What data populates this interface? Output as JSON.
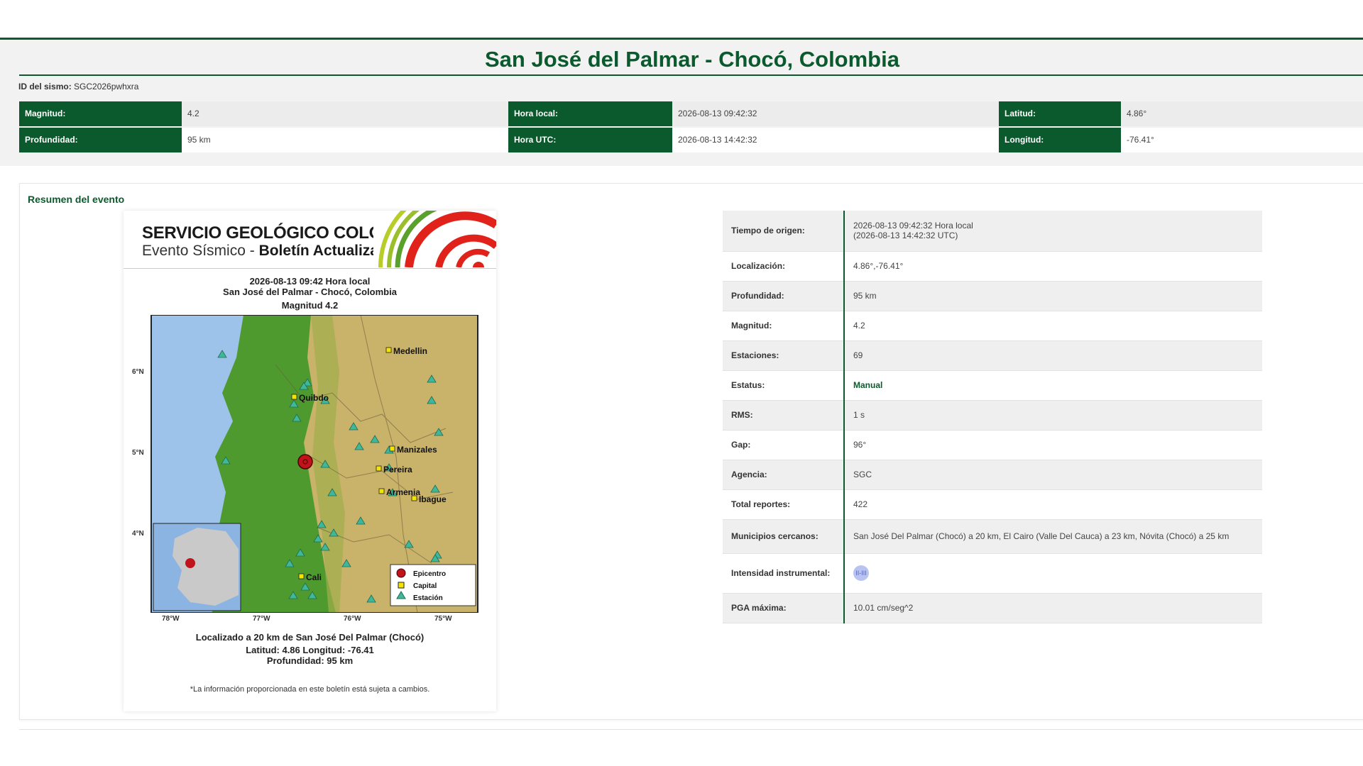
{
  "header": {
    "title": "San José del Palmar - Chocó, Colombia",
    "event_id_label": "ID del sismo:",
    "event_id_value": "SGC2026pwhxra"
  },
  "summary": {
    "magnitude_label": "Magnitud:",
    "magnitude_value": "4.2",
    "depth_label": "Profundidad:",
    "depth_value": "95 km",
    "local_time_label": "Hora local:",
    "local_time_value": "2026-08-13 09:42:32",
    "utc_time_label": "Hora UTC:",
    "utc_time_value": "2026-08-13 14:42:32",
    "latitude_label": "Latitud:",
    "latitude_value": "4.86°",
    "longitude_label": "Longitud:",
    "longitude_value": "-76.41°"
  },
  "section": {
    "title": "Resumen del evento"
  },
  "bulletin": {
    "org_name": "SERVICIO GEOLÓGICO COLOMBIANO",
    "subtitle_prefix": "Evento Sísmico - ",
    "subtitle_bold": "Boletín Actualizado",
    "caption_datetime": "2026-08-13 09:42 Hora local",
    "caption_place": "San José del Palmar - Chocó, Colombia",
    "caption_magnitude": "Magnitud 4.2",
    "location_text": "Localizado a 20 km de San José Del Palmar (Chocó)",
    "coords_text": "Latitud: 4.86 Longitud: -76.41",
    "depth_text": "Profundidad: 95 km",
    "disclaimer": "*La información proporcionada en este boletín está sujeta a cambios.",
    "map": {
      "lat_ticks": [
        "6°N",
        "5°N",
        "4°N"
      ],
      "lon_ticks": [
        "78°W",
        "77°W",
        "76°W",
        "75°W"
      ],
      "cities": [
        "Medellin",
        "Quibdo",
        "Manizales",
        "Pereira",
        "Armenia",
        "Ibague",
        "Cali"
      ],
      "legend": {
        "epicenter": "Epicentro",
        "capital": "Capital",
        "station": "Estación"
      },
      "colors": {
        "sea": "#9ec3ea",
        "lowland": "#4f9a2f",
        "highland": "#c9b26a",
        "epicenter": "#c0141a",
        "capital": "#f5e400",
        "station": "#3fb89a"
      }
    }
  },
  "details": {
    "origin_time_label": "Tiempo de origen:",
    "origin_time_line1": "2026-08-13 09:42:32 Hora local",
    "origin_time_line2": "(2026-08-13 14:42:32 UTC)",
    "location_label": "Localización:",
    "location_value": "4.86°,-76.41°",
    "depth_label": "Profundidad:",
    "depth_value": "95 km",
    "magnitude_label": "Magnitud:",
    "magnitude_value": "4.2",
    "stations_label": "Estaciones:",
    "stations_value": "69",
    "status_label": "Estatus:",
    "status_value": "Manual",
    "rms_label": "RMS:",
    "rms_value": "1 s",
    "gap_label": "Gap:",
    "gap_value": "96°",
    "agency_label": "Agencia:",
    "agency_value": "SGC",
    "reports_label": "Total reportes:",
    "reports_value": "422",
    "nearby_label": "Municipios cercanos:",
    "nearby_value": "San José Del Palmar (Chocó) a 20 km, El Cairo (Valle Del Cauca) a 23 km, Nóvita (Chocó) a 25 km",
    "intensity_label": "Intensidad instrumental:",
    "intensity_value": "II-III",
    "pga_label": "PGA máxima:",
    "pga_value": "10.01 cm/seg^2"
  },
  "colors": {
    "brand_green": "#0b5a2e",
    "status_green": "#0b5a2e",
    "intensity_badge": "#b9c3f2"
  }
}
